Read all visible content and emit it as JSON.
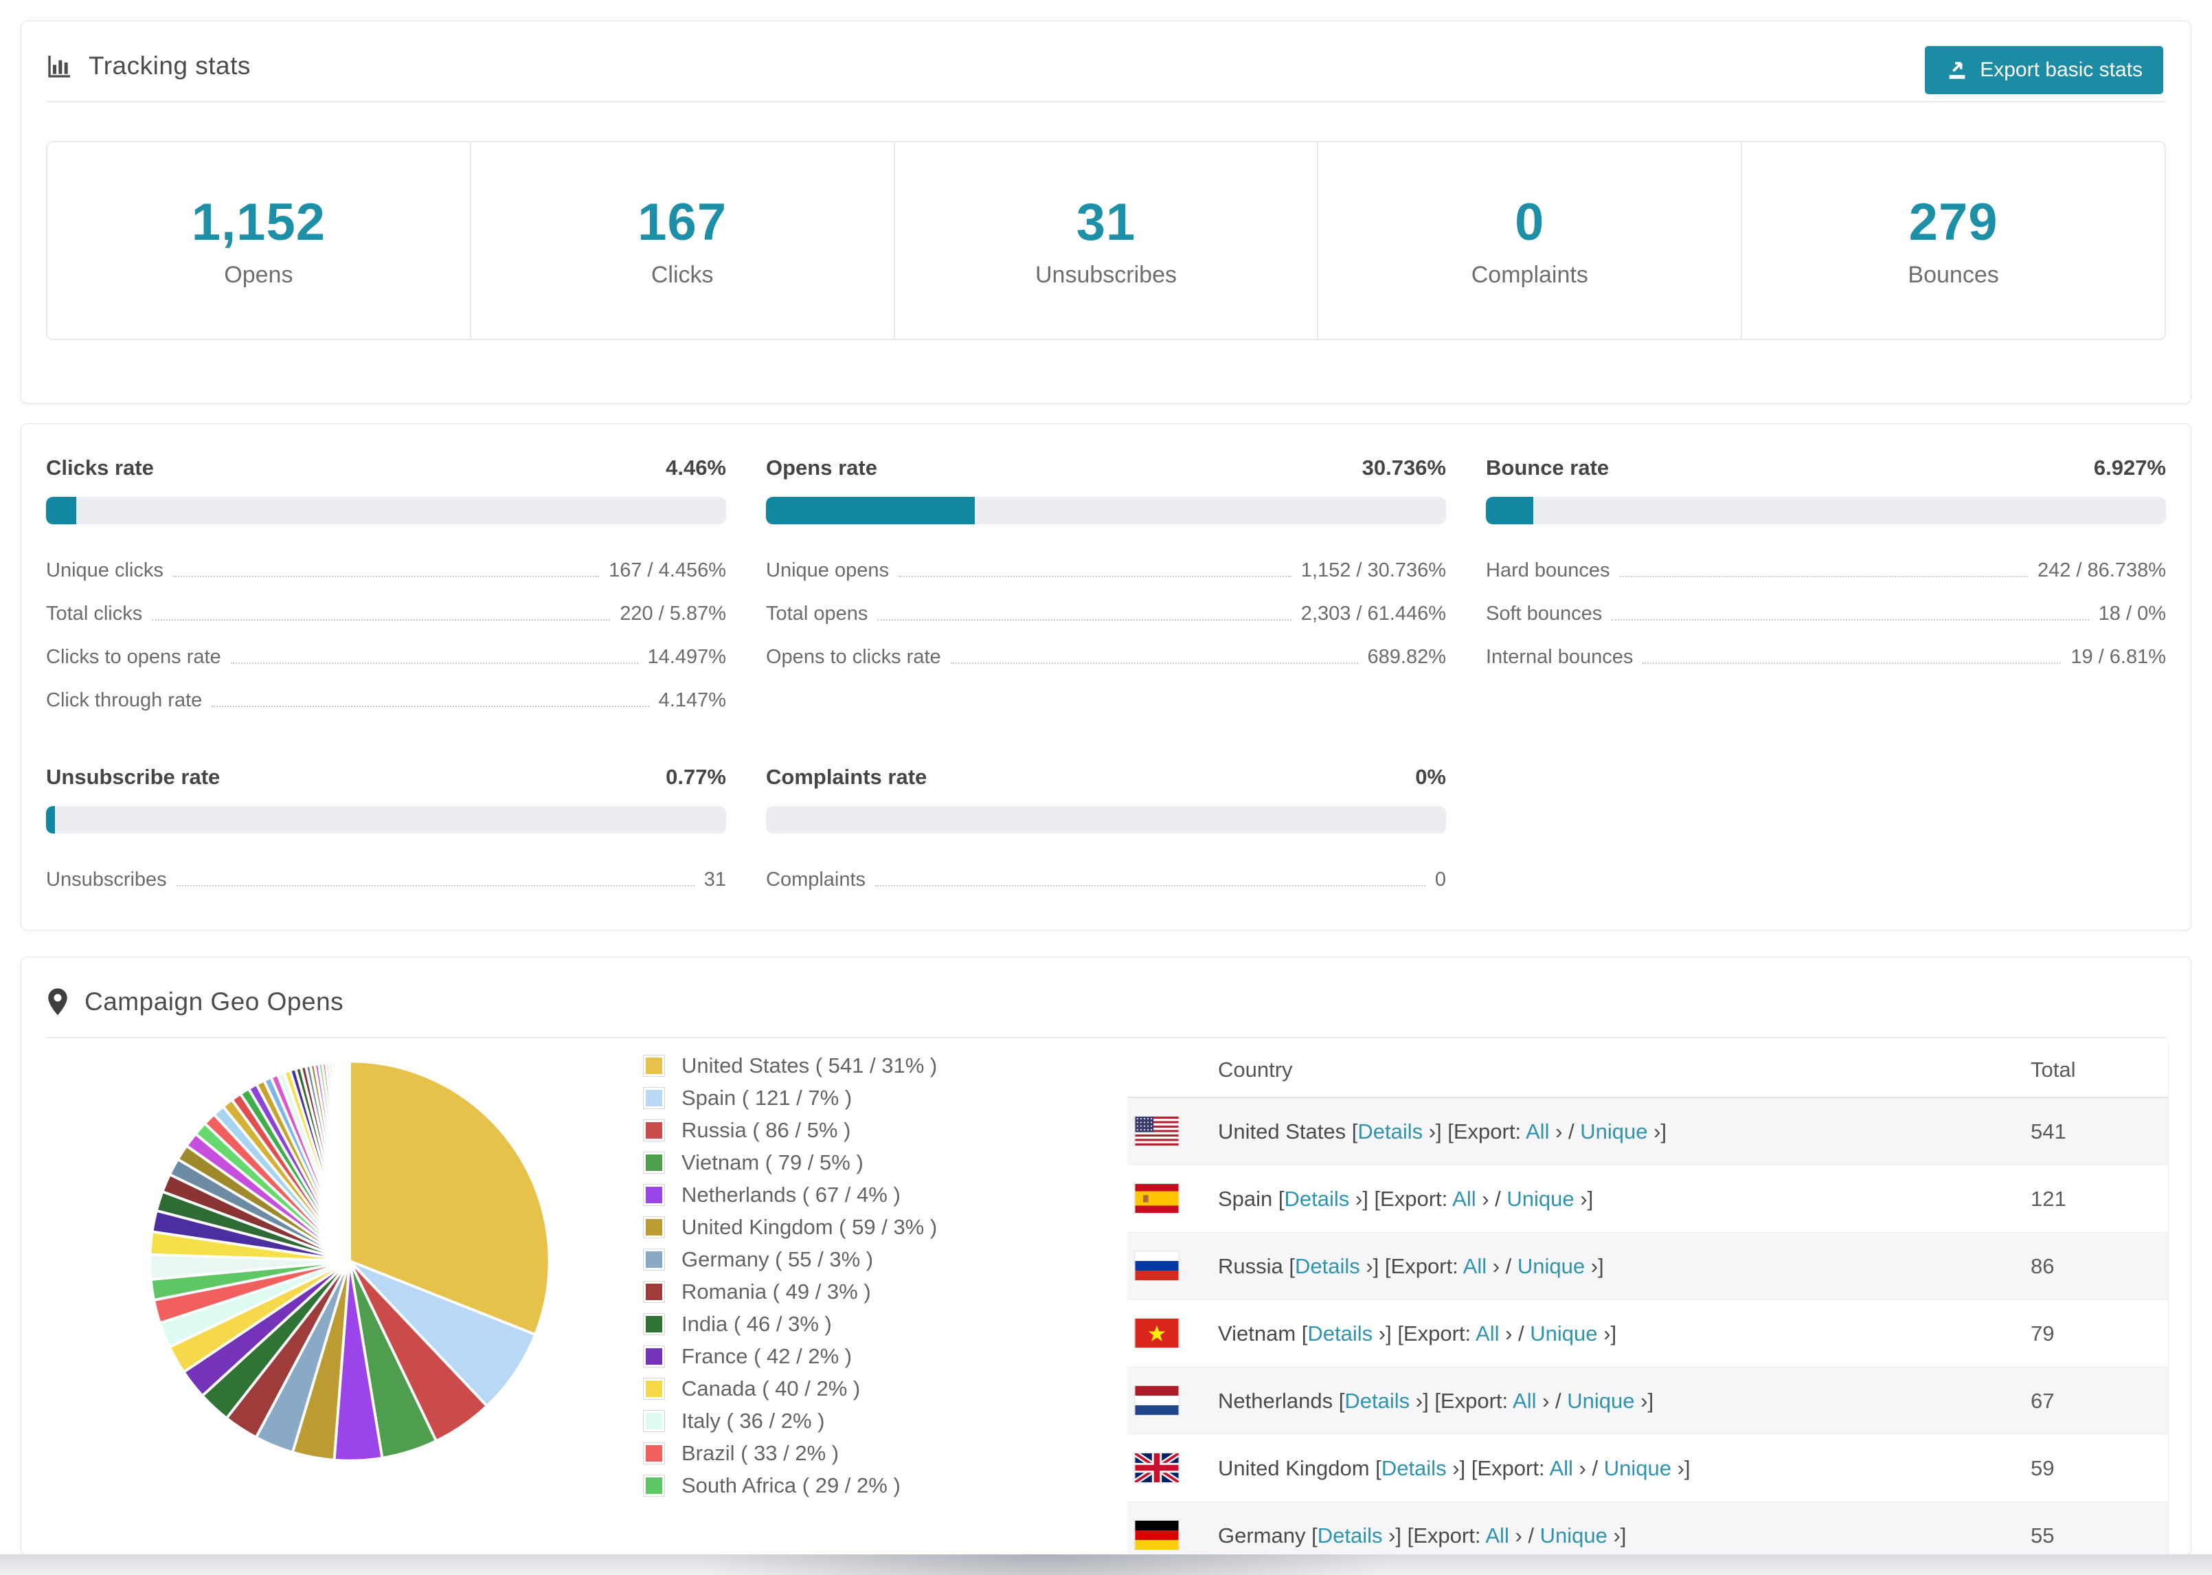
{
  "colors": {
    "accent_teal": "#1b8ca3",
    "number_teal": "#1d8fa6",
    "bar_fill_teal": "#1187a0",
    "link_teal": "#2e93ae",
    "bar_track": "#ebedf1"
  },
  "tracking": {
    "title": "Tracking stats",
    "export_button_label": "Export basic stats",
    "stats": [
      {
        "value": "1,152",
        "label": "Opens"
      },
      {
        "value": "167",
        "label": "Clicks"
      },
      {
        "value": "31",
        "label": "Unsubscribes"
      },
      {
        "value": "0",
        "label": "Complaints"
      },
      {
        "value": "279",
        "label": "Bounces"
      }
    ]
  },
  "rates": [
    {
      "id": "clicks",
      "label": "Clicks rate",
      "value": "4.46%",
      "percent": 4.46,
      "rows": [
        {
          "label": "Unique clicks",
          "value": "167 / 4.456%"
        },
        {
          "label": "Total clicks",
          "value": "220 / 5.87%"
        },
        {
          "label": "Clicks to opens rate",
          "value": "14.497%"
        },
        {
          "label": "Click through rate",
          "value": "4.147%"
        }
      ]
    },
    {
      "id": "opens",
      "label": "Opens rate",
      "value": "30.736%",
      "percent": 30.736,
      "rows": [
        {
          "label": "Unique opens",
          "value": "1,152 / 30.736%"
        },
        {
          "label": "Total opens",
          "value": "2,303 / 61.446%"
        },
        {
          "label": "Opens to clicks rate",
          "value": "689.82%"
        }
      ]
    },
    {
      "id": "bounce",
      "label": "Bounce rate",
      "value": "6.927%",
      "percent": 6.927,
      "rows": [
        {
          "label": "Hard bounces",
          "value": "242 / 86.738%"
        },
        {
          "label": "Soft bounces",
          "value": "18 / 0%"
        },
        {
          "label": "Internal bounces",
          "value": "19 / 6.81%"
        }
      ]
    },
    {
      "id": "unsubscribe",
      "label": "Unsubscribe rate",
      "value": "0.77%",
      "percent": 0.77,
      "rows": [
        {
          "label": "Unsubscribes",
          "value": "31"
        }
      ]
    },
    {
      "id": "complaints",
      "label": "Complaints rate",
      "value": "0%",
      "percent": 0,
      "rows": [
        {
          "label": "Complaints",
          "value": "0"
        }
      ]
    }
  ],
  "geo": {
    "title": "Campaign Geo Opens",
    "table": {
      "columns": [
        "Country",
        "Total"
      ],
      "details_label": "Details",
      "export_label": "Export:",
      "all_label": "All",
      "unique_label": "Unique",
      "chevron": "›",
      "bracket_open": "[",
      "bracket_close": "]",
      "slash": "/",
      "rows": [
        {
          "country": "United States",
          "total": "541",
          "flag": "us"
        },
        {
          "country": "Spain",
          "total": "121",
          "flag": "es"
        },
        {
          "country": "Russia",
          "total": "86",
          "flag": "ru"
        },
        {
          "country": "Vietnam",
          "total": "79",
          "flag": "vn"
        },
        {
          "country": "Netherlands",
          "total": "67",
          "flag": "nl"
        },
        {
          "country": "United Kingdom",
          "total": "59",
          "flag": "gb"
        },
        {
          "country": "Germany",
          "total": "55",
          "flag": "de"
        }
      ]
    }
  },
  "chart_data": {
    "type": "pie",
    "title": "Campaign Geo Opens",
    "start_angle_deg": -90,
    "direction": "clockwise",
    "total_estimated": 1745,
    "others_estimated_total": 462,
    "others_slice_count": 38,
    "series": [
      {
        "name": "United States",
        "value": 541,
        "pct": "31%",
        "color": "#e7c24a",
        "legend_label": "United States ( 541 / 31% )"
      },
      {
        "name": "Spain",
        "value": 121,
        "pct": "7%",
        "color": "#b8d8f5",
        "legend_label": "Spain ( 121 / 7% )"
      },
      {
        "name": "Russia",
        "value": 86,
        "pct": "5%",
        "color": "#cb4b4b",
        "legend_label": "Russia ( 86 / 5% )"
      },
      {
        "name": "Vietnam",
        "value": 79,
        "pct": "5%",
        "color": "#4f9e4f",
        "legend_label": "Vietnam ( 79 / 5% )"
      },
      {
        "name": "Netherlands",
        "value": 67,
        "pct": "4%",
        "color": "#9b44ea",
        "legend_label": "Netherlands ( 67 / 4% )"
      },
      {
        "name": "United Kingdom",
        "value": 59,
        "pct": "3%",
        "color": "#bd9b33",
        "legend_label": "United Kingdom ( 59 / 3% )"
      },
      {
        "name": "Germany",
        "value": 55,
        "pct": "3%",
        "color": "#8aa9c7",
        "legend_label": "Germany ( 55 / 3% )"
      },
      {
        "name": "Romania",
        "value": 49,
        "pct": "3%",
        "color": "#9e3c3c",
        "legend_label": "Romania ( 49 / 3% )"
      },
      {
        "name": "India",
        "value": 46,
        "pct": "3%",
        "color": "#2f7434",
        "legend_label": "India ( 46 / 3% )"
      },
      {
        "name": "France",
        "value": 42,
        "pct": "2%",
        "color": "#7433b8",
        "legend_label": "France ( 42 / 2% )"
      },
      {
        "name": "Canada",
        "value": 40,
        "pct": "2%",
        "color": "#f6d94a",
        "legend_label": "Canada ( 40 / 2% )"
      },
      {
        "name": "Italy",
        "value": 36,
        "pct": "2%",
        "color": "#ddfaf3",
        "legend_label": "Italy ( 36 / 2% )"
      },
      {
        "name": "Brazil",
        "value": 33,
        "pct": "2%",
        "color": "#f15f5f",
        "legend_label": "Brazil ( 33 / 2% )"
      },
      {
        "name": "South Africa",
        "value": 29,
        "pct": "2%",
        "color": "#5ec764",
        "legend_label": "South Africa ( 29 / 2% )"
      }
    ],
    "tail_palette": [
      "#e8f7f1",
      "#f6e04a",
      "#4b2ea0",
      "#2f6b34",
      "#8a3434",
      "#6e8ba4",
      "#9e8a2a",
      "#c74fe0",
      "#66d96e",
      "#f15f5f",
      "#a8d4f2",
      "#d4b23a",
      "#e04f4f",
      "#3fae4a",
      "#8a44d8",
      "#c9a22e",
      "#7fb6e8",
      "#e055c9"
    ]
  }
}
